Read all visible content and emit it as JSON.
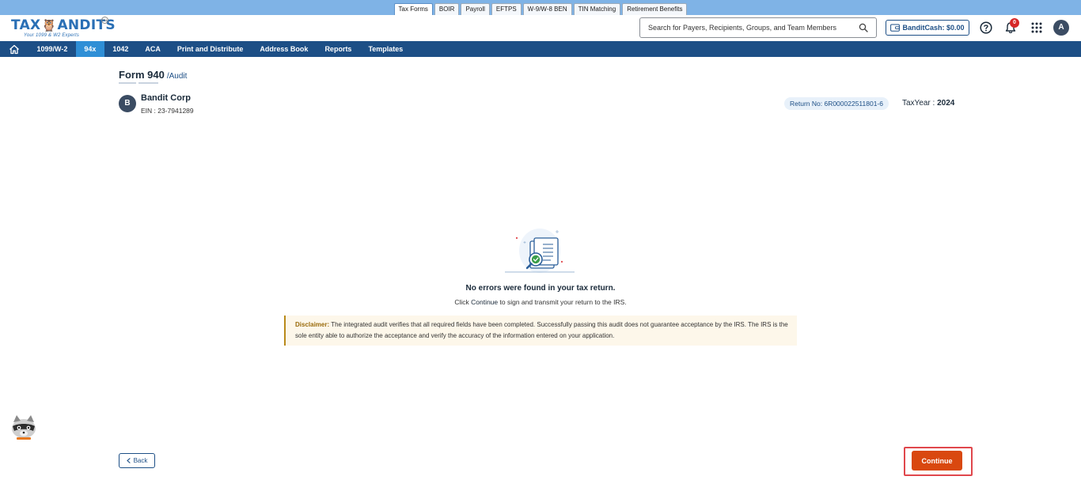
{
  "product_tabs": [
    "Tax Forms",
    "BOIR",
    "Payroll",
    "EFTPS",
    "W-9/W-8 BEN",
    "TIN Matching",
    "Retirement Benefits"
  ],
  "active_product_tab": "Tax Forms",
  "logo": {
    "text_left": "TAX",
    "text_right": "ANDITS",
    "tm": "TM",
    "tagline": "Your 1099 & W2 Experts"
  },
  "search": {
    "placeholder": "Search for Payers, Recipients, Groups, and Team Members"
  },
  "bandit_cash": "BanditCash: $0.00",
  "notifications": {
    "count": "0"
  },
  "user": {
    "initial": "A"
  },
  "nav": {
    "items": [
      "1099/W-2",
      "94x",
      "1042",
      "ACA",
      "Print and Distribute",
      "Address Book",
      "Reports",
      "Templates"
    ],
    "active": "94x"
  },
  "page": {
    "title": "Form 940",
    "subtitle": "/Audit"
  },
  "company": {
    "initial": "B",
    "name": "Bandit Corp",
    "ein": "EIN : 23-7941289"
  },
  "return_no": "Return No: 6R000022511801-6",
  "tax_year": {
    "label": "TaxYear :",
    "value": "2024"
  },
  "result": {
    "title": "No errors were found in your tax return.",
    "sub_prefix": "Click",
    "sub_action": "Continue",
    "sub_suffix": "to sign and transmit your return to the IRS."
  },
  "disclaimer": {
    "label": "Disclaimer:",
    "text": "The integrated audit verifies that all required fields have been completed. Successfully passing this audit does not guarantee acceptance by the IRS. The IRS is the sole entity able to authorize the acceptance and verify the accuracy of the information entered on your application."
  },
  "buttons": {
    "back": "Back",
    "continue": "Continue"
  },
  "colors": {
    "primary": "#1d4f86",
    "accent": "#2f8fd6",
    "continue": "#d9480f",
    "highlight": "#e0474c",
    "badge": "#d62828"
  }
}
